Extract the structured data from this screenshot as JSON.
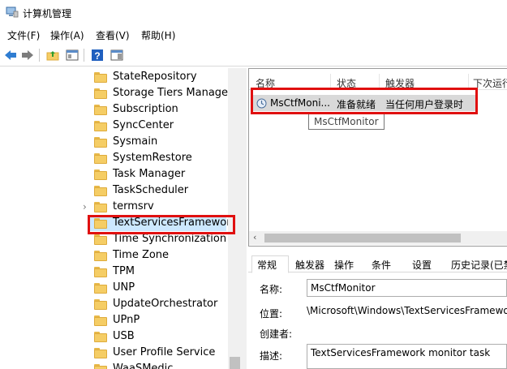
{
  "window": {
    "title": "计算机管理",
    "app_icon": "computer-management-icon"
  },
  "menu": [
    {
      "label": "文件(F)"
    },
    {
      "label": "操作(A)"
    },
    {
      "label": "查看(V)"
    },
    {
      "label": "帮助(H)"
    }
  ],
  "toolbar": {
    "icons": [
      "back-arrow-icon",
      "forward-arrow-icon",
      "up-folder-icon",
      "show-hide-tree-icon",
      "help-icon",
      "action-pane-icon"
    ]
  },
  "tree": {
    "items": [
      {
        "label": "StateRepository"
      },
      {
        "label": "Storage Tiers Managem"
      },
      {
        "label": "Subscription"
      },
      {
        "label": "SyncCenter"
      },
      {
        "label": "Sysmain"
      },
      {
        "label": "SystemRestore"
      },
      {
        "label": "Task Manager"
      },
      {
        "label": "TaskScheduler"
      },
      {
        "label": "termsrv",
        "expandable": true
      },
      {
        "label": "TextServicesFramework",
        "selected": true
      },
      {
        "label": "Time Synchronization"
      },
      {
        "label": "Time Zone"
      },
      {
        "label": "TPM"
      },
      {
        "label": "UNP"
      },
      {
        "label": "UpdateOrchestrator"
      },
      {
        "label": "UPnP"
      },
      {
        "label": "USB"
      },
      {
        "label": "User Profile Service"
      },
      {
        "label": "WaaSMedic"
      }
    ]
  },
  "task_list": {
    "columns": [
      "名称",
      "状态",
      "触发器",
      "下次运行"
    ],
    "rows": [
      {
        "name": "MsCtfMoni...",
        "status": "准备就绪",
        "trigger": "当任何用户登录时",
        "icon": "scheduled-task-icon"
      }
    ],
    "tooltip": "MsCtfMonitor"
  },
  "details": {
    "tabs": [
      "常规",
      "触发器",
      "操作",
      "条件",
      "设置",
      "历史记录(已禁"
    ],
    "active_tab": "常规",
    "name_label": "名称:",
    "name_value": "MsCtfMonitor",
    "location_label": "位置:",
    "location_value": "\\Microsoft\\Windows\\TextServicesFramewo",
    "author_label": "创建者:",
    "description_label": "描述:",
    "description_value": "TextServicesFramework monitor task"
  },
  "colors": {
    "highlight": "#e01010",
    "selection": "#cce8ff",
    "row_selected": "#d9d9d9"
  }
}
